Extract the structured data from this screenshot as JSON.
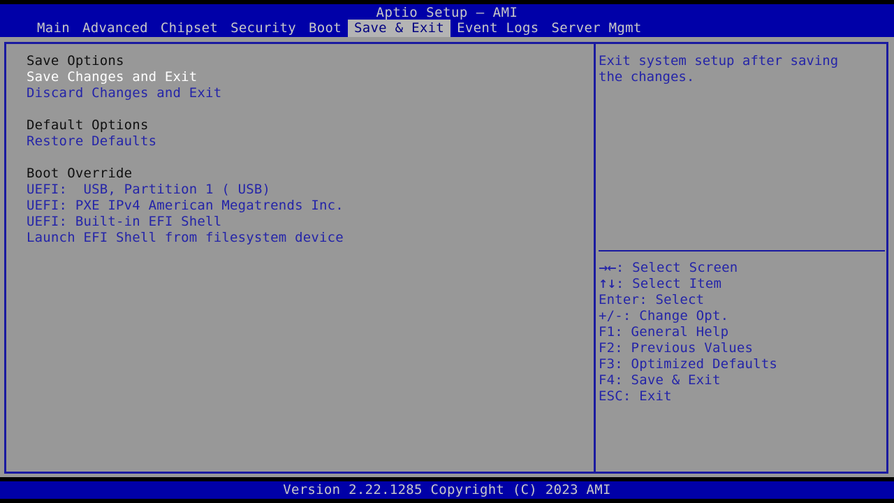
{
  "title_bar": {
    "title": "Aptio Setup – AMI"
  },
  "menu": {
    "items": [
      {
        "label": "Main",
        "selected": false
      },
      {
        "label": "Advanced",
        "selected": false
      },
      {
        "label": "Chipset",
        "selected": false
      },
      {
        "label": "Security",
        "selected": false
      },
      {
        "label": "Boot",
        "selected": false
      },
      {
        "label": "Save & Exit",
        "selected": true
      },
      {
        "label": "Event Logs",
        "selected": false
      },
      {
        "label": "Server Mgmt",
        "selected": false
      }
    ]
  },
  "left_panel": {
    "rows": [
      {
        "text": "Save Options",
        "kind": "header"
      },
      {
        "text": "Save Changes and Exit",
        "kind": "selected"
      },
      {
        "text": "Discard Changes and Exit",
        "kind": "link"
      },
      {
        "text": "",
        "kind": "spacer"
      },
      {
        "text": "Default Options",
        "kind": "header"
      },
      {
        "text": "Restore Defaults",
        "kind": "link"
      },
      {
        "text": "",
        "kind": "spacer"
      },
      {
        "text": "Boot Override",
        "kind": "header"
      },
      {
        "text": "UEFI:  USB, Partition 1 ( USB)",
        "kind": "link"
      },
      {
        "text": "UEFI: PXE IPv4 American Megatrends Inc.",
        "kind": "link"
      },
      {
        "text": "UEFI: Built-in EFI Shell",
        "kind": "link"
      },
      {
        "text": "Launch EFI Shell from filesystem device",
        "kind": "link"
      }
    ]
  },
  "right_panel": {
    "help_text": "Exit system setup after saving\nthe changes.",
    "key_help": [
      {
        "glyph": "→←",
        "text": ": Select Screen"
      },
      {
        "glyph": "↑↓",
        "text": ": Select Item"
      },
      {
        "glyph": "",
        "text": "Enter: Select"
      },
      {
        "glyph": "",
        "text": "+/-: Change Opt."
      },
      {
        "glyph": "",
        "text": "F1: General Help"
      },
      {
        "glyph": "",
        "text": "F2: Previous Values"
      },
      {
        "glyph": "",
        "text": "F3: Optimized Defaults"
      },
      {
        "glyph": "",
        "text": "F4: Save & Exit"
      },
      {
        "glyph": "",
        "text": "ESC: Exit"
      }
    ]
  },
  "footer": {
    "version_text": "Version 2.22.1285 Copyright (C) 2023 AMI"
  },
  "colors": {
    "bios_blue": "#0000a8",
    "panel_gray": "#989898",
    "text_blue": "#2424a8",
    "border_blue": "#1a1aa0",
    "selected_tab_bg": "#b4b4b4",
    "menu_text": "#c8c8c8",
    "selected_item": "#ffffff",
    "header_text": "#101010"
  }
}
